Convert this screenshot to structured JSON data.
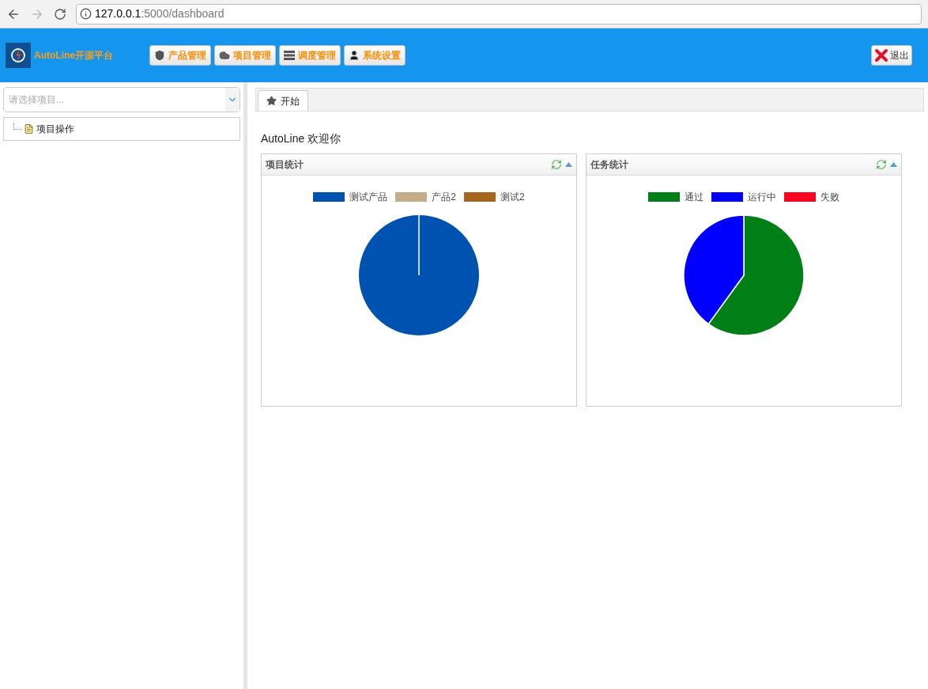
{
  "browser": {
    "url_host": "127.0.0.1",
    "url_path": ":5000/dashboard"
  },
  "header": {
    "brand": "AutoLine开源平台",
    "menu": [
      {
        "label": "产品管理",
        "kind": "shield"
      },
      {
        "label": "项目管理",
        "kind": "cloud"
      },
      {
        "label": "调度管理",
        "kind": "list"
      },
      {
        "label": "系统设置",
        "kind": "user"
      }
    ],
    "logout": "退出"
  },
  "sidebar": {
    "project_select": {
      "placeholder": "请选择项目..."
    },
    "tree": [
      {
        "label": "项目操作"
      }
    ]
  },
  "tabs": [
    {
      "label": "开始",
      "selected": true
    }
  ],
  "welcome": "AutoLine 欢迎你",
  "panels": [
    {
      "title": "项目统计",
      "legend": [
        {
          "label": "测试产品",
          "color": "#0052b0"
        },
        {
          "label": "产品2",
          "color": "#c4ad89"
        },
        {
          "label": "测试2",
          "color": "#a7651e"
        }
      ]
    },
    {
      "title": "任务统计",
      "legend": [
        {
          "label": "通过",
          "color": "#007f16"
        },
        {
          "label": "运行中",
          "color": "#0000ff"
        },
        {
          "label": "失败",
          "color": "#ff0021"
        }
      ]
    }
  ]
}
